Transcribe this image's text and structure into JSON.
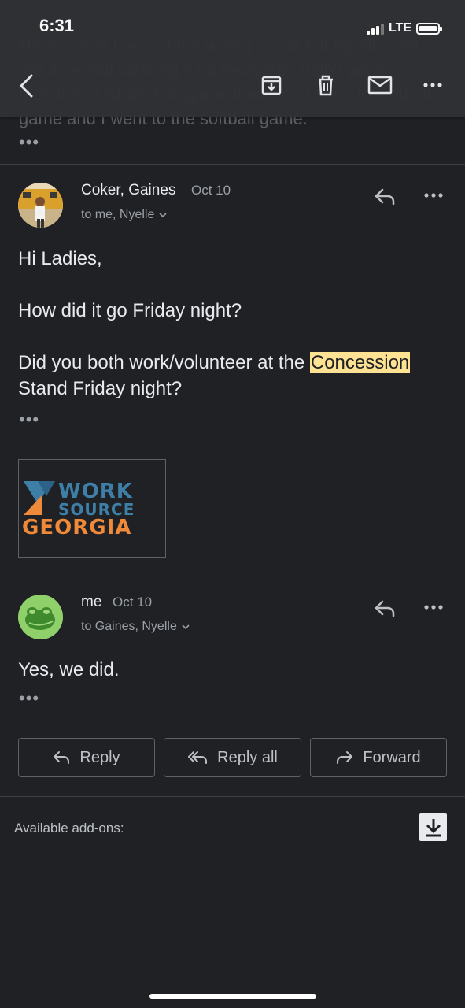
{
  "status": {
    "time": "6:31",
    "network": "LTE"
  },
  "background_text": "Never mind I was at the wrong stand but Nyelle sent me an email clearing it up because I didn't get a mention of which ball game it was so I went to softball game and I went to the softball game.",
  "toolbar": {
    "back": "back-icon",
    "archive": "archive-icon",
    "delete": "trash-icon",
    "mark_unread": "mail-icon",
    "more": "more-icon"
  },
  "thread": {
    "prev_more": "•••",
    "messages": [
      {
        "sender": "Coker, Gaines",
        "date": "Oct 10",
        "recipients": "to me, Nyelle",
        "greeting": "Hi Ladies,",
        "line1": "How did it go Friday night?",
        "line2_before": "Did you both work/volunteer at the ",
        "line2_highlight": "Concession",
        "line2_after": "Stand Friday night?",
        "more": "•••",
        "signature_logo": {
          "line1": "WORK",
          "line2": "SOURCE",
          "line3": "GEORGIA"
        }
      },
      {
        "sender": "me",
        "date": "Oct 10",
        "recipients": "to Gaines, Nyelle",
        "body": "Yes, we did.",
        "more": "•••"
      }
    ]
  },
  "actions": {
    "reply": "Reply",
    "reply_all": "Reply all",
    "forward": "Forward"
  },
  "addons": {
    "label": "Available add-ons:"
  },
  "colors": {
    "background": "#202124",
    "toolbar": "#303134",
    "highlight": "#fde293",
    "logo_orange": "#ef8a3b",
    "logo_blue": "#3e7fa8"
  }
}
